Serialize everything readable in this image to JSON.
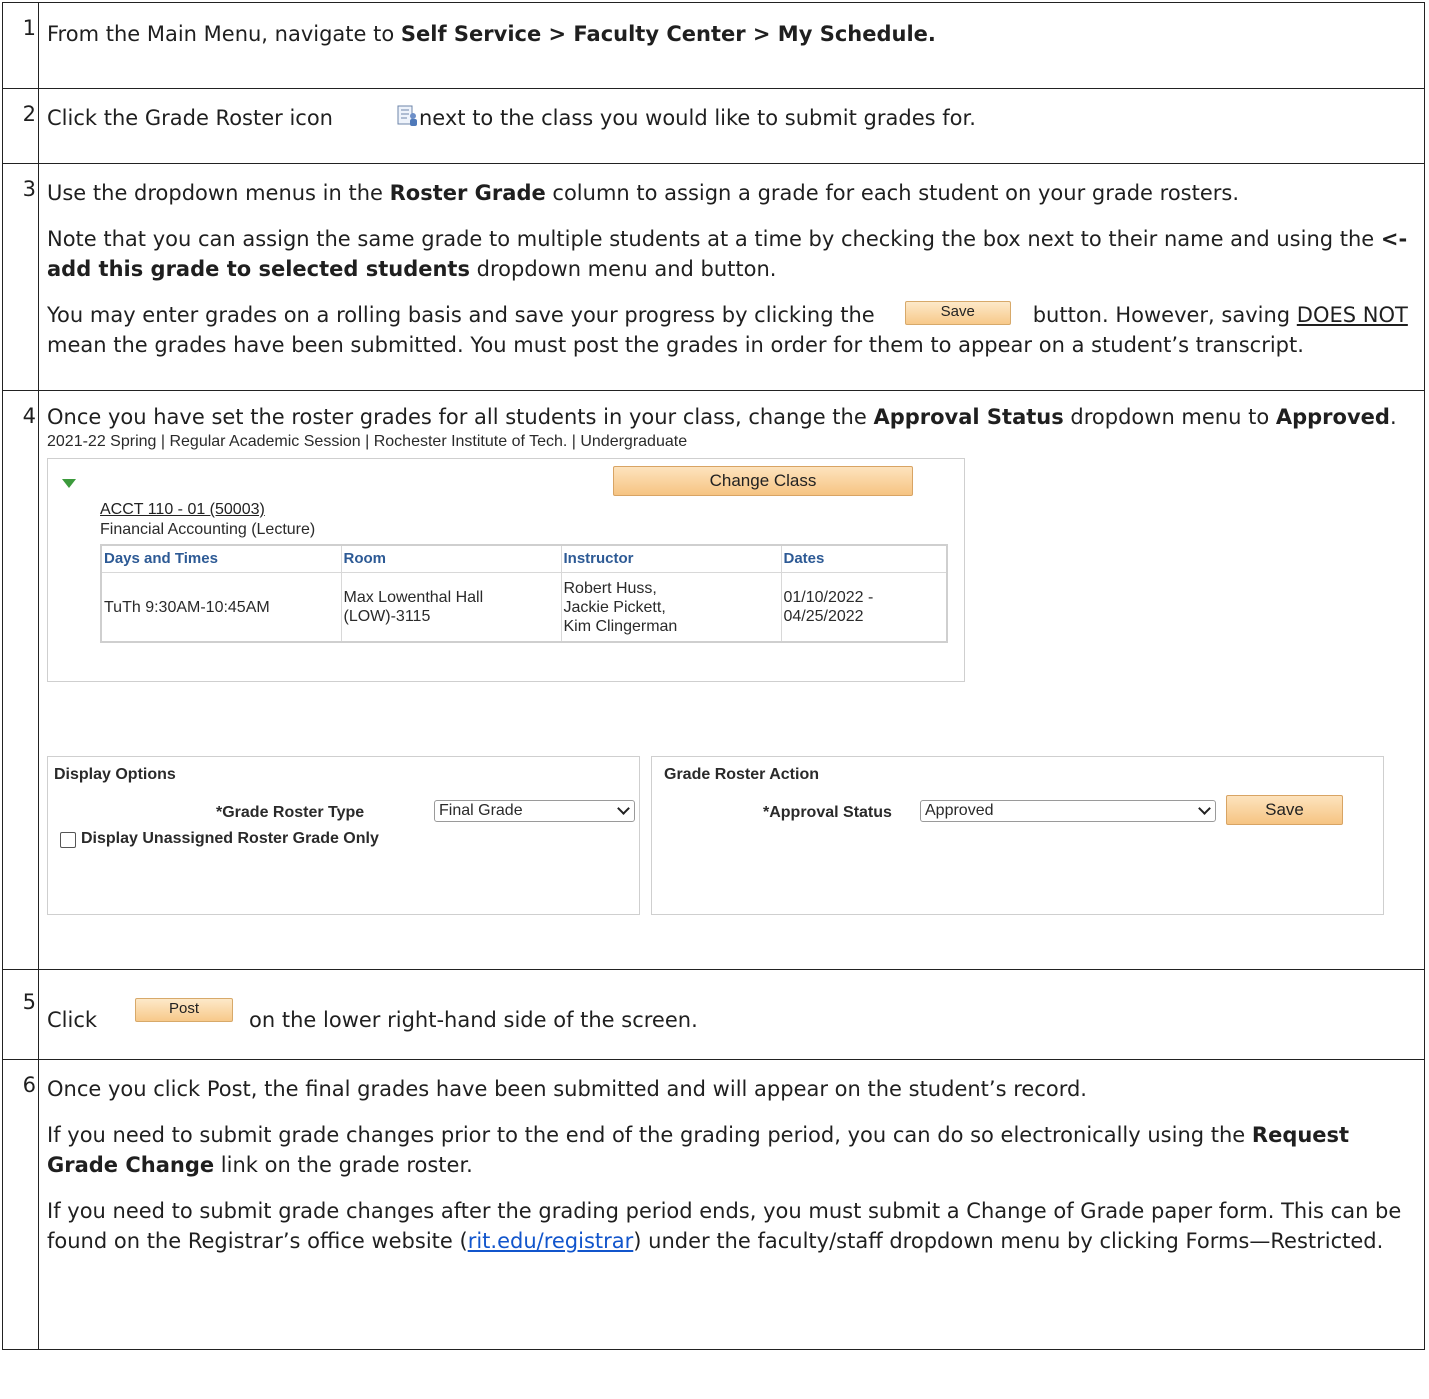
{
  "steps": [
    {
      "num": "1",
      "pre": "From the Main Menu, navigate to ",
      "bold": "Self Service > Faculty Center > My Schedule."
    },
    {
      "num": "2",
      "pre": "Click the Grade Roster icon",
      "post": "next to the class you would like to submit grades for.",
      "icon": "grade-roster-icon"
    },
    {
      "num": "3",
      "p1_pre": "Use the dropdown menus in the ",
      "p1_bold": "Roster Grade",
      "p1_post": " column to assign a grade for each student on your grade rosters.",
      "p2_pre": "Note that you can assign the same grade to multiple students at a time by checking the box next to their name and using the ",
      "p2_bold": "<-add this grade to selected students",
      "p2_post": " dropdown menu and button.",
      "p3_pre": "You may enter grades on a rolling basis and save your progress by clicking the",
      "p3_button": "Save",
      "p3_mid": "button. However, saving ",
      "p3_underline": "DOES NOT",
      "p3_post": " mean the grades have been submitted. You must post the grades in order for them to appear on a student’s transcript."
    },
    {
      "num": "4",
      "pre": "Once you have set the roster grades for all students in your class, change the ",
      "bold1": "Approval Status",
      "mid": " dropdown menu to ",
      "bold2": "Approved",
      "post": "."
    },
    {
      "num": "5",
      "pre": "Click",
      "button": "Post",
      "post": "on the lower right-hand side of the screen."
    },
    {
      "num": "6",
      "p1": "Once you click Post, the final grades have been submitted and will appear on the student’s record.",
      "p2_pre": "If you need to submit grade changes prior to the end of the grading period, you can do so electronically using the ",
      "p2_bold": "Request Grade Change",
      "p2_post": " link on the grade roster.",
      "p3_pre": "If you need to submit grade changes after the grading period ends, you must submit a Change of Grade paper form. This can be found on the Registrar’s office website (",
      "p3_link": "rit.edu/registrar",
      "p3_post": ") under the faculty/staff dropdown menu by clicking Forms—Restricted."
    }
  ],
  "screenshot": {
    "term": "2021-22 Spring | Regular Academic Session | Rochester Institute of Tech. | Undergraduate",
    "change_class": "Change Class",
    "class_link": "ACCT 110 - 01 (50003)",
    "class_title": "Financial Accounting (Lecture)",
    "schedule_headers": [
      "Days and Times",
      "Room",
      "Instructor",
      "Dates"
    ],
    "schedule_row": {
      "days": "TuTh 9:30AM-10:45AM",
      "room": "Max Lowenthal Hall (LOW)-3115",
      "instructor_lines": [
        "Robert Huss,",
        "Jackie Pickett,",
        "Kim Clingerman"
      ],
      "dates": "01/10/2022 - 04/25/2022"
    },
    "display_options_title": "Display Options",
    "grade_roster_type_label": "*Grade Roster Type",
    "grade_roster_type_value": "Final Grade",
    "unassigned_label": "Display Unassigned Roster Grade Only",
    "grade_roster_action_title": "Grade Roster Action",
    "approval_status_label": "*Approval Status",
    "approval_status_value": "Approved",
    "save_button": "Save"
  },
  "colors": {
    "button_orange": "#f6c483",
    "header_blue": "#2d5a95",
    "link_blue": "#1155cc",
    "triangle_green": "#3c9a3c"
  }
}
